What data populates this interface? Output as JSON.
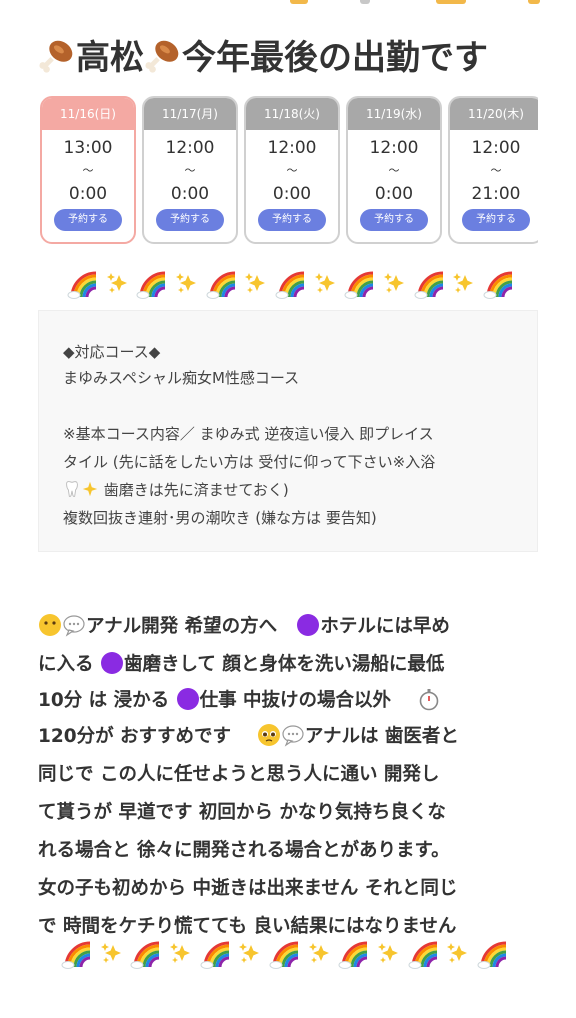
{
  "headline": {
    "part1": "高松",
    "part2": "今年最後の出勤です",
    "icon": "poultry-leg-icon"
  },
  "schedule": [
    {
      "date": "11/16(日)",
      "start": "13:00",
      "sep": "〜",
      "end": "0:00",
      "button": "予約する",
      "highlight": true
    },
    {
      "date": "11/17(月)",
      "start": "12:00",
      "sep": "〜",
      "end": "0:00",
      "button": "予約する",
      "highlight": false
    },
    {
      "date": "11/18(火)",
      "start": "12:00",
      "sep": "〜",
      "end": "0:00",
      "button": "予約する",
      "highlight": false
    },
    {
      "date": "11/19(水)",
      "start": "12:00",
      "sep": "〜",
      "end": "0:00",
      "button": "予約する",
      "highlight": false
    },
    {
      "date": "11/20(木)",
      "start": "12:00",
      "sep": "〜",
      "end": "21:00",
      "button": "予約する",
      "highlight": false
    }
  ],
  "course": {
    "heading": "◆対応コース◆",
    "name": "まゆみスペシャル痴女M性感コース",
    "note1": "※基本コース内容／ まゆみ式 逆夜這い侵入 即プレイス",
    "note2": "タイル (先に話をしたい方は 受付に仰って下さい※入浴",
    "note3": "歯磨きは先に済ませておく)",
    "note4": "複数回抜き連射･男の潮吹き (嫌な方は 要告知)"
  },
  "body_lines": [
    "アナル開発 希望の方へ",
    "ホテルには早め",
    "に入る",
    "歯磨きして 顔と身体を洗い湯船に最低",
    "10分 は 浸かる",
    "仕事 中抜けの場合以外",
    "120分が おすすめです",
    "アナルは 歯医者と",
    "同じで この人に任せようと思う人に通い 開発し",
    "て貰うが 早道です 初回から かなり気持ち良くな",
    "れる場合と 徐々に開発される場合とがあります。",
    "女の子も初めから 中逝きは出来ません それと同じ",
    "で 時間をケチり慌てても 良い結果にはなりません"
  ],
  "colors": {
    "accent_button": "#6b7fe0",
    "today_header": "#f4a9a3",
    "day_header": "#a8a8a8",
    "purple_dot": "#8a2be2"
  }
}
